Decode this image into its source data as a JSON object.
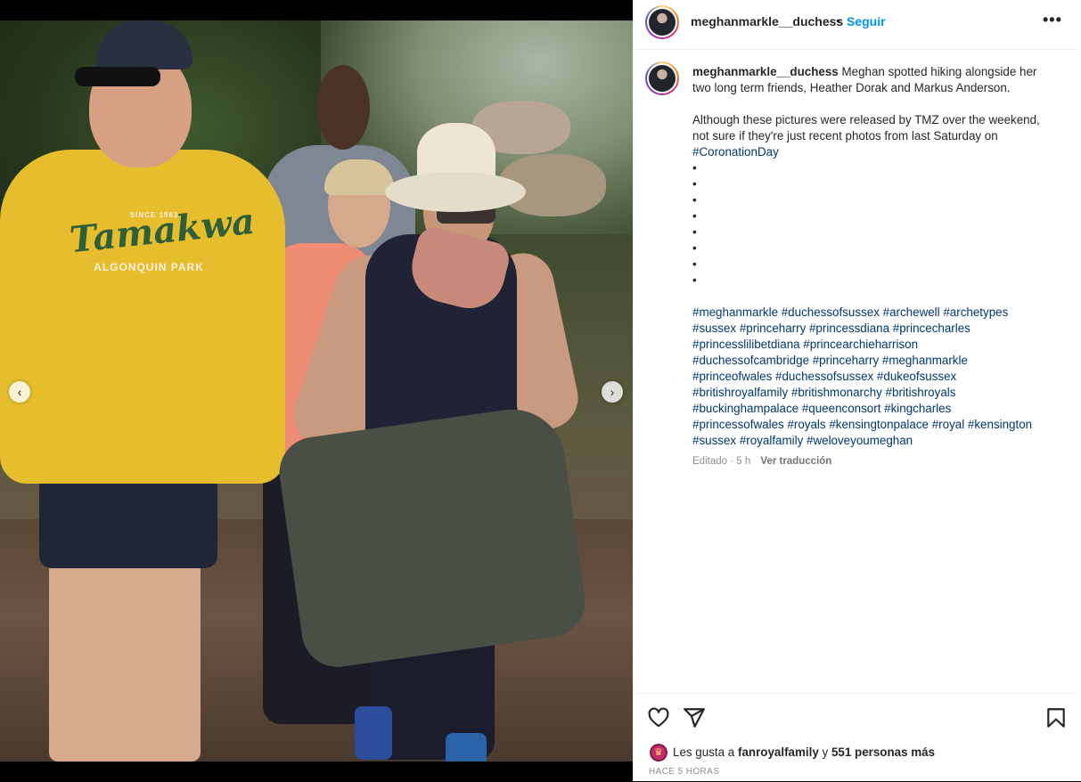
{
  "post": {
    "username": "meghanmarkle__duchess",
    "follow_label": "Seguir",
    "separator": "•",
    "more_label": "•••",
    "caption_text": "Meghan spotted hiking alongside her two long term friends, Heather Dorak and Markus Anderson.",
    "caption_para2": "Although these pictures were released by TMZ over the weekend, not sure if they're just recent photos from last Saturday on",
    "caption_tag_inline": "#CoronationDay",
    "bullets": [
      "•",
      "•",
      "•",
      "•",
      "•",
      "•",
      "•",
      "•"
    ],
    "hashtag_lines": [
      "#meghanmarkle #duchessofsussex #archewell #archetypes",
      "#sussex #princeharry #princessdiana #princecharles",
      "#princesslilibetdiana #princearchieharrison",
      "#duchessofcambridge #princeharry #meghanmarkle",
      "#princeofwales #duchessofsussex #dukeofsussex",
      "#britishroyalfamily #britishmonarchy #britishroyals",
      "#buckinghampalace #queenconsort #kingcharles",
      "#princessofwales #royals #kensingtonpalace #royal #kensington",
      "#sussex #royalfamily #weloveyoumeghan"
    ],
    "edited_label": "Editado · 5 h",
    "translate_label": "Ver traducción",
    "likes_prefix": "Les gusta a",
    "likes_user": "fanroyalfamily",
    "likes_conj": "y",
    "likes_count": "551 personas más",
    "time_ago": "HACE 5 HORAS"
  },
  "photo": {
    "shirt_since": "SINCE 1963",
    "shirt_brand": "Tamakwa",
    "shirt_sub": "ALGONQUIN PARK",
    "carousel_total_dots": 4,
    "carousel_active_index": 0
  },
  "nav": {
    "prev": "‹",
    "next": "›"
  },
  "colors": {
    "link": "#0095f6",
    "hashtag": "#00376b",
    "muted": "#8e8e8e"
  },
  "icons": [
    "heart-icon",
    "share-icon",
    "bookmark-icon",
    "more-icon",
    "chevron-left-icon",
    "chevron-right-icon"
  ]
}
